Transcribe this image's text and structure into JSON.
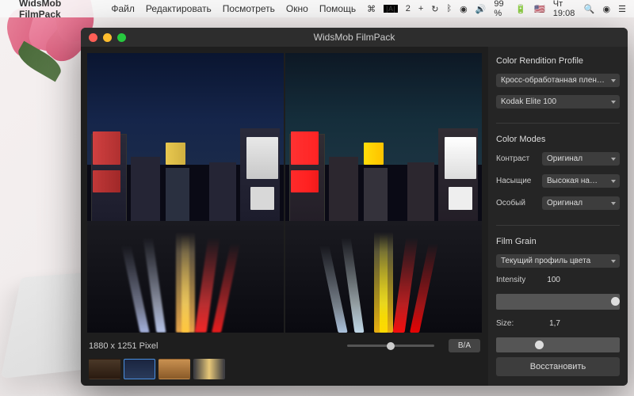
{
  "menubar": {
    "app_name": "WidsMob FilmPack",
    "items": [
      "Файл",
      "Редактировать",
      "Посмотреть",
      "Окно",
      "Помощь"
    ],
    "right": {
      "adobe": "A",
      "battery": "99 %",
      "flag": "🇺🇸",
      "clock": "Чт 19:08"
    }
  },
  "window": {
    "title": "WidsMob FilmPack"
  },
  "footer": {
    "dimensions": "1880 x 1251 Pixel",
    "ba_label": "B/A"
  },
  "sidebar": {
    "profile": {
      "title": "Color Rendition Profile",
      "dd1": "Кросс-обработанная плен…",
      "dd2": "Kodak Elite 100"
    },
    "modes": {
      "title": "Color Modes",
      "rows": [
        {
          "label": "Контраст",
          "value": "Оригинал"
        },
        {
          "label": "Насыщие",
          "value": "Высокая на…"
        },
        {
          "label": "Особый",
          "value": "Оригинал"
        }
      ]
    },
    "grain": {
      "title": "Film Grain",
      "dd": "Текущий профиль цвета",
      "intensity_label": "Intensity",
      "intensity_value": "100",
      "size_label": "Size:",
      "size_value": "1,7"
    },
    "restore": "Восстановить"
  }
}
